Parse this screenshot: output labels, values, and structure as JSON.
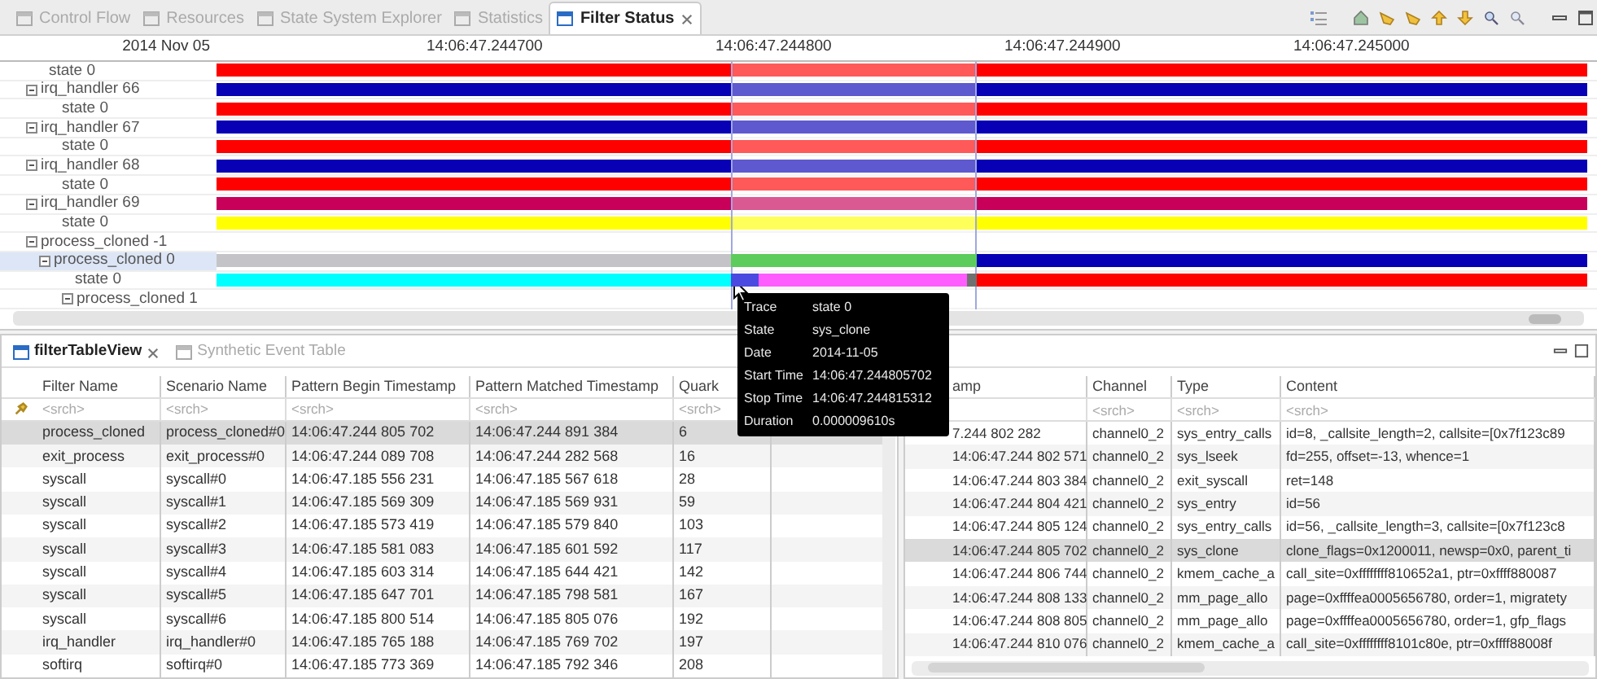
{
  "tabs": [
    {
      "label": "Control Flow",
      "selected": false
    },
    {
      "label": "Resources",
      "selected": false
    },
    {
      "label": "State System Explorer",
      "selected": false
    },
    {
      "label": "Statistics",
      "selected": false
    },
    {
      "label": "Filter Status",
      "selected": true
    }
  ],
  "timeline": {
    "date": "2014 Nov 05",
    "ticks": [
      "14:06:47.244700",
      "14:06:47.244800",
      "14:06:47.244900",
      "14:06:47.245000"
    ],
    "rows": [
      {
        "label": "state 0",
        "selected": false,
        "segments": [
          {
            "color": "#ff0000"
          }
        ]
      },
      {
        "label": "irq_handler 66",
        "selected": false,
        "expanded": true,
        "segments": [
          {
            "color": "#0800b4"
          }
        ],
        "children": [
          {
            "label": "state 0",
            "selected": false,
            "segments": [
              {
                "color": "#ff0000"
              }
            ]
          }
        ]
      },
      {
        "label": "irq_handler 67",
        "selected": false,
        "expanded": true,
        "segments": [
          {
            "color": "#0800b4"
          }
        ],
        "children": [
          {
            "label": "state 0",
            "selected": false,
            "segments": [
              {
                "color": "#ff0000"
              }
            ]
          }
        ]
      },
      {
        "label": "irq_handler 68",
        "selected": false,
        "expanded": true,
        "segments": [
          {
            "color": "#0800b4"
          }
        ],
        "children": [
          {
            "label": "state 0",
            "selected": false,
            "segments": [
              {
                "color": "#ff0000"
              }
            ]
          }
        ]
      },
      {
        "label": "irq_handler 69",
        "selected": false,
        "expanded": true,
        "segments": [
          {
            "color": "#c8005a"
          }
        ],
        "children": [
          {
            "label": "state 0",
            "selected": false,
            "segments": [
              {
                "color": "#ffff00"
              }
            ]
          }
        ]
      },
      {
        "label": "process_cloned -1",
        "selected": false,
        "expanded": true,
        "children": [
          {
            "label": "process_cloned 0",
            "selected": true,
            "expanded": true,
            "segments": [
              {
                "color": "#c4c4c8"
              },
              {
                "color": "#5ccc5c"
              },
              {
                "color": "#0800b4"
              }
            ],
            "children": [
              {
                "label": "state 0",
                "selected": false,
                "segments": [
                  {
                    "color": "#00ffff"
                  },
                  {
                    "color": "#4a4ae0"
                  },
                  {
                    "color": "#ff5cff"
                  },
                  {
                    "color": "#707070"
                  },
                  {
                    "color": "#ff0000"
                  }
                ]
              }
            ]
          },
          {
            "label": "process_cloned 1",
            "selected": false,
            "expanded": true
          }
        ]
      }
    ]
  },
  "tooltip": [
    {
      "label": "Trace",
      "value": "state 0"
    },
    {
      "label": "State",
      "value": "sys_clone"
    },
    {
      "label": "Date",
      "value": "2014-11-05"
    },
    {
      "label": "Start Time",
      "value": "14:06:47.244805702"
    },
    {
      "label": "Stop Time",
      "value": "14:06:47.244815312"
    },
    {
      "label": "Duration",
      "value": "0.000009610s"
    }
  ],
  "left_panel": {
    "tabs": [
      {
        "label": "filterTableView",
        "selected": true
      },
      {
        "label": "Synthetic Event Table",
        "selected": false
      }
    ],
    "columns": [
      {
        "label": "Filter Name",
        "search": "<srch>"
      },
      {
        "label": "Scenario Name",
        "search": "<srch>"
      },
      {
        "label": "Pattern Begin Timestamp",
        "search": "<srch>"
      },
      {
        "label": "Pattern Matched Timestamp",
        "search": "<srch>"
      },
      {
        "label": "Quark",
        "search": "<srch>"
      }
    ],
    "rows": [
      {
        "selected": true,
        "cells": [
          "process_cloned",
          "process_cloned#0",
          "14:06:47.244 805 702",
          "14:06:47.244 891 384",
          "6"
        ]
      },
      {
        "selected": false,
        "cells": [
          "exit_process",
          "exit_process#0",
          "14:06:47.244 089 708",
          "14:06:47.244 282 568",
          "16"
        ]
      },
      {
        "selected": false,
        "cells": [
          "syscall",
          "syscall#0",
          "14:06:47.185 556 231",
          "14:06:47.185 567 618",
          "28"
        ]
      },
      {
        "selected": false,
        "cells": [
          "syscall",
          "syscall#1",
          "14:06:47.185 569 309",
          "14:06:47.185 569 931",
          "59"
        ]
      },
      {
        "selected": false,
        "cells": [
          "syscall",
          "syscall#2",
          "14:06:47.185 573 419",
          "14:06:47.185 579 840",
          "103"
        ]
      },
      {
        "selected": false,
        "cells": [
          "syscall",
          "syscall#3",
          "14:06:47.185 581 083",
          "14:06:47.185 601 592",
          "117"
        ]
      },
      {
        "selected": false,
        "cells": [
          "syscall",
          "syscall#4",
          "14:06:47.185 603 314",
          "14:06:47.185 644 421",
          "142"
        ]
      },
      {
        "selected": false,
        "cells": [
          "syscall",
          "syscall#5",
          "14:06:47.185 647 701",
          "14:06:47.185 798 581",
          "167"
        ]
      },
      {
        "selected": false,
        "cells": [
          "syscall",
          "syscall#6",
          "14:06:47.185 800 514",
          "14:06:47.185 805 076",
          "192"
        ]
      },
      {
        "selected": false,
        "cells": [
          "irq_handler",
          "irq_handler#0",
          "14:06:47.185 765 188",
          "14:06:47.185 769 702",
          "197"
        ]
      },
      {
        "selected": false,
        "cells": [
          "softirq",
          "softirq#0",
          "14:06:47.185 773 369",
          "14:06:47.185 792 346",
          "208"
        ]
      }
    ]
  },
  "right_panel": {
    "columns": [
      {
        "label": "amp"
      },
      {
        "label": "Channel",
        "search": "<srch>"
      },
      {
        "label": "Type",
        "search": "<srch>"
      },
      {
        "label": "Content",
        "search": "<srch>"
      }
    ],
    "rows": [
      {
        "selected": false,
        "cells": [
          "7.244 802 282",
          "channel0_2",
          "sys_entry_calls",
          "id=8, _callsite_length=2, callsite=[0x7f123c89"
        ]
      },
      {
        "selected": false,
        "cells": [
          "14:06:47.244 802 571",
          "channel0_2",
          "sys_lseek",
          "fd=255, offset=-13, whence=1"
        ]
      },
      {
        "selected": false,
        "cells": [
          "14:06:47.244 803 384",
          "channel0_2",
          "exit_syscall",
          "ret=148"
        ]
      },
      {
        "selected": false,
        "cells": [
          "14:06:47.244 804 421",
          "channel0_2",
          "sys_entry",
          "id=56"
        ]
      },
      {
        "selected": false,
        "cells": [
          "14:06:47.244 805 124",
          "channel0_2",
          "sys_entry_calls",
          "id=56, _callsite_length=3, callsite=[0x7f123c8"
        ]
      },
      {
        "selected": true,
        "cells": [
          "14:06:47.244 805 702",
          "channel0_2",
          "sys_clone",
          "clone_flags=0x1200011, newsp=0x0, parent_ti"
        ]
      },
      {
        "selected": false,
        "cells": [
          "14:06:47.244 806 744",
          "channel0_2",
          "kmem_cache_a",
          "call_site=0xffffffff810652a1, ptr=0xffff880087"
        ]
      },
      {
        "selected": false,
        "cells": [
          "14:06:47.244 808 133",
          "channel0_2",
          "mm_page_allo",
          "page=0xffffea0005656780, order=1, migratety"
        ]
      },
      {
        "selected": false,
        "cells": [
          "14:06:47.244 808 805",
          "channel0_2",
          "mm_page_allo",
          "page=0xffffea0005656780, order=1, gfp_flags"
        ]
      },
      {
        "selected": false,
        "cells": [
          "14:06:47.244 810 076",
          "channel0_2",
          "kmem_cache_a",
          "call_site=0xffffffff8101c80e, ptr=0xffff88008f"
        ]
      }
    ]
  }
}
